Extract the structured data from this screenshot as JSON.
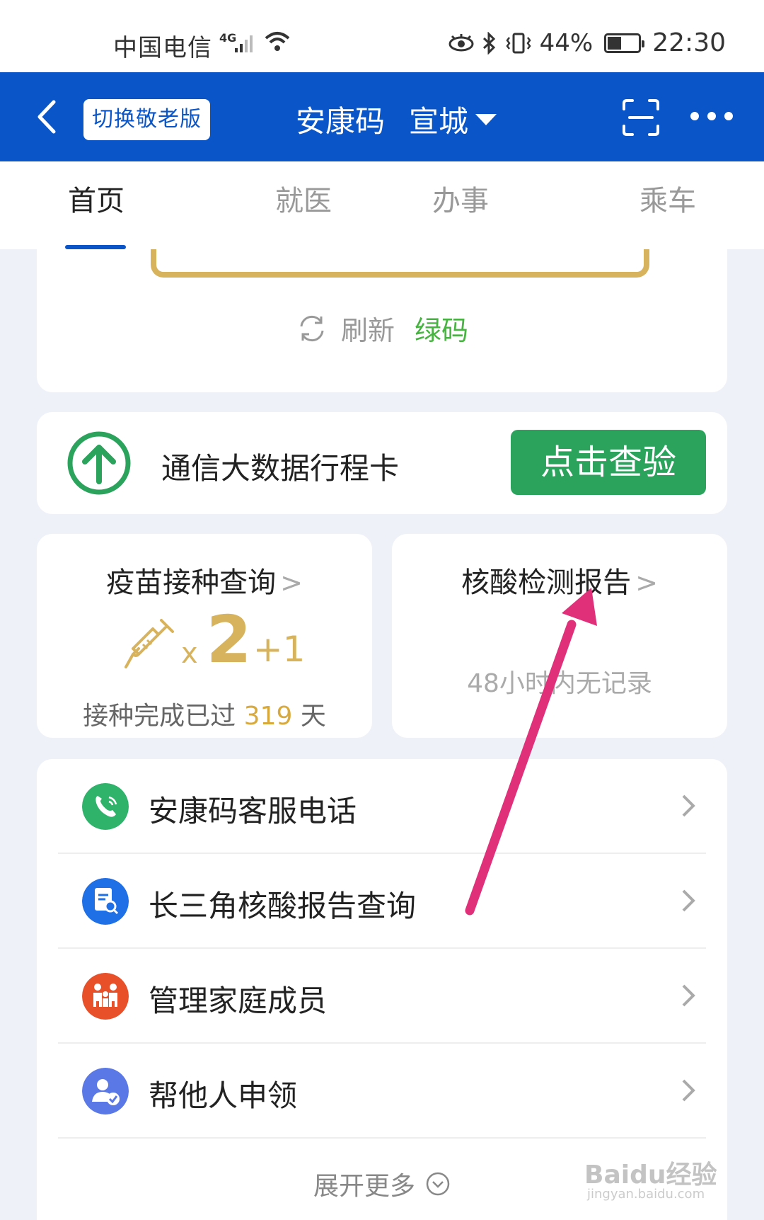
{
  "status_bar": {
    "carrier": "中国电信",
    "network": "4G",
    "battery": "44%",
    "battery_level": 0.44,
    "time": "22:30"
  },
  "app_bar": {
    "elder_mode_label": "切换敬老版",
    "title": "安康码",
    "city": "宣城"
  },
  "tabs": [
    {
      "label": "首页",
      "active": true
    },
    {
      "label": "就医",
      "active": false
    },
    {
      "label": "办事",
      "active": false
    },
    {
      "label": "乘车",
      "active": false
    }
  ],
  "health_code": {
    "refresh_label": "刷新",
    "status": "绿码",
    "status_color": "#47b340"
  },
  "itinerary": {
    "label": "通信大数据行程卡",
    "button": "点击查验",
    "button_color": "#2ba35c"
  },
  "vaccine": {
    "title": "疫苗接种查询",
    "multiplier": "x",
    "doses": "2",
    "extra": "+1",
    "days_prefix": "接种完成已过",
    "days": "319",
    "days_suffix": "天"
  },
  "test_report": {
    "title": "核酸检测报告",
    "status": "48小时内无记录"
  },
  "services": [
    {
      "label": "安康码客服电话",
      "icon": "phone-icon",
      "color": "#2fb36b"
    },
    {
      "label": "长三角核酸报告查询",
      "icon": "report-search-icon",
      "color": "#1f6fe6"
    },
    {
      "label": "管理家庭成员",
      "icon": "family-icon",
      "color": "#e8502a"
    },
    {
      "label": "帮他人申领",
      "icon": "user-check-icon",
      "color": "#5a78e6"
    }
  ],
  "expand_label": "展开更多",
  "watermark": {
    "brand": "Baidu经验",
    "url": "jingyan.baidu.com"
  },
  "colors": {
    "primary": "#0a55c8",
    "gold": "#d8b35d"
  }
}
